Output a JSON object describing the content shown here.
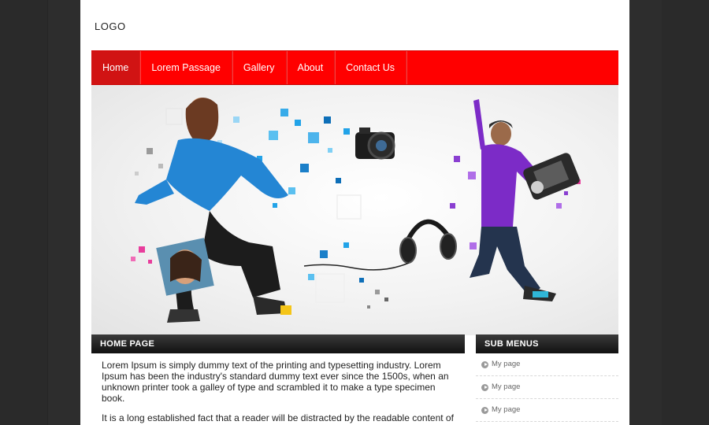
{
  "header": {
    "logo_text": "LOGO"
  },
  "nav": {
    "items": [
      {
        "label": "Home",
        "active": true
      },
      {
        "label": "Lorem Passage",
        "active": false
      },
      {
        "label": "Gallery",
        "active": false
      },
      {
        "label": "About",
        "active": false
      },
      {
        "label": "Contact Us",
        "active": false
      }
    ]
  },
  "main": {
    "heading": "HOME PAGE",
    "paragraphs": [
      "Lorem Ipsum is simply dummy text of the printing and typesetting industry. Lorem Ipsum has been the industry's standard dummy text ever since the 1500s, when an unknown printer took a galley of type and scrambled it to make a type specimen book.",
      "It is a long established fact that a reader will be distracted by the readable content of a page when looking at its layout. The point of using Lorem Ipsum is that it has a"
    ]
  },
  "sidebar": {
    "heading": "SUB MENUS",
    "items": [
      {
        "label": "My page"
      },
      {
        "label": "My page"
      },
      {
        "label": "My page"
      }
    ]
  },
  "colors": {
    "nav_red": "#ff0000",
    "nav_active": "#d11313",
    "bar_dark": "#1a1a1a",
    "accent_blue": "#1e90d6",
    "accent_purple": "#8a3fd1"
  }
}
